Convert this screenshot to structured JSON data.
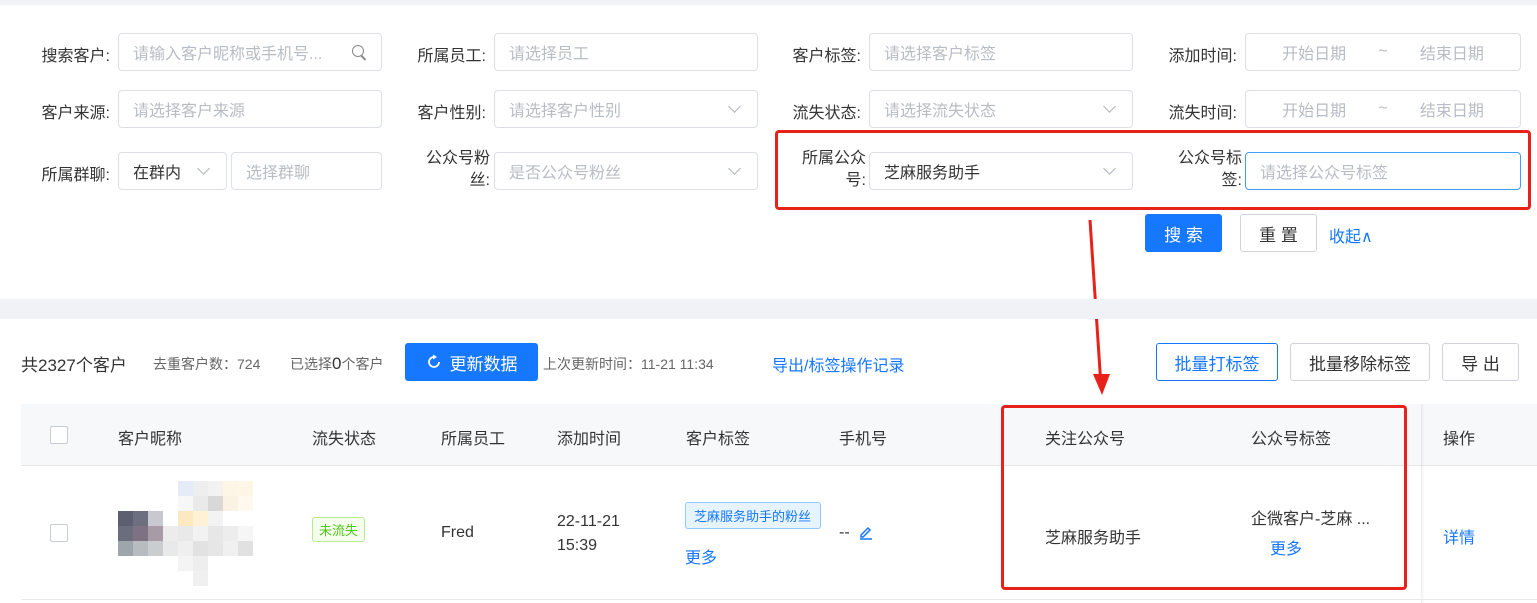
{
  "filters": {
    "row1": [
      {
        "label": "搜索客户:",
        "placeholder": "请输入客户昵称或手机号..."
      },
      {
        "label": "所属员工:",
        "placeholder": "请选择员工"
      },
      {
        "label": "客户标签:",
        "placeholder": "请选择客户标签"
      },
      {
        "label": "添加时间:",
        "start": "开始日期",
        "sep": "~",
        "end": "结束日期"
      }
    ],
    "row2": [
      {
        "label": "客户来源:",
        "placeholder": "请选择客户来源"
      },
      {
        "label": "客户性别:",
        "placeholder": "请选择客户性别"
      },
      {
        "label": "流失状态:",
        "placeholder": "请选择流失状态"
      },
      {
        "label": "流失时间:",
        "start": "开始日期",
        "sep": "~",
        "end": "结束日期"
      }
    ],
    "row3": {
      "group_label": "所属群聊:",
      "group_select": "在群内",
      "group_placeholder": "选择群聊",
      "fans_label": "公众号粉丝:",
      "fans_placeholder": "是否公众号粉丝",
      "oa_label": "所属公众号:",
      "oa_value": "芝麻服务助手",
      "oa_tag_label": "公众号标签:",
      "oa_tag_placeholder": "请选择公众号标签"
    },
    "search_button": "搜 索",
    "reset_button": "重 置",
    "collapse_link": "收起∧"
  },
  "toolbar": {
    "total": "共2327个客户",
    "dedup": "去重客户数：724",
    "selected_prefix": "已选择",
    "selected_count": "0",
    "selected_suffix": "个客户",
    "refresh_button": "更新数据",
    "last_update": "上次更新时间：11-21 11:34",
    "export_record_link": "导出/标签操作记录",
    "batch_tag_button": "批量打标签",
    "batch_remove_button": "批量移除标签",
    "export_button": "导 出"
  },
  "table": {
    "headers": [
      "客户昵称",
      "流失状态",
      "所属员工",
      "添加时间",
      "客户标签",
      "手机号",
      "关注公众号",
      "公众号标签",
      "操作"
    ],
    "rows": [
      {
        "status": "未流失",
        "employee": "Fred",
        "date": "22-11-21",
        "time": "15:39",
        "tag": "芝麻服务助手的粉丝",
        "tag_more": "更多",
        "phone": "--",
        "oa": "芝麻服务助手",
        "oa_tag": "企微客户-芝麻 ...",
        "oa_tag_more": "更多",
        "action": "详情"
      }
    ]
  },
  "colors": {
    "primary": "#1677ff",
    "annotation_red": "#e8221a",
    "status_green": "#52c41a"
  }
}
